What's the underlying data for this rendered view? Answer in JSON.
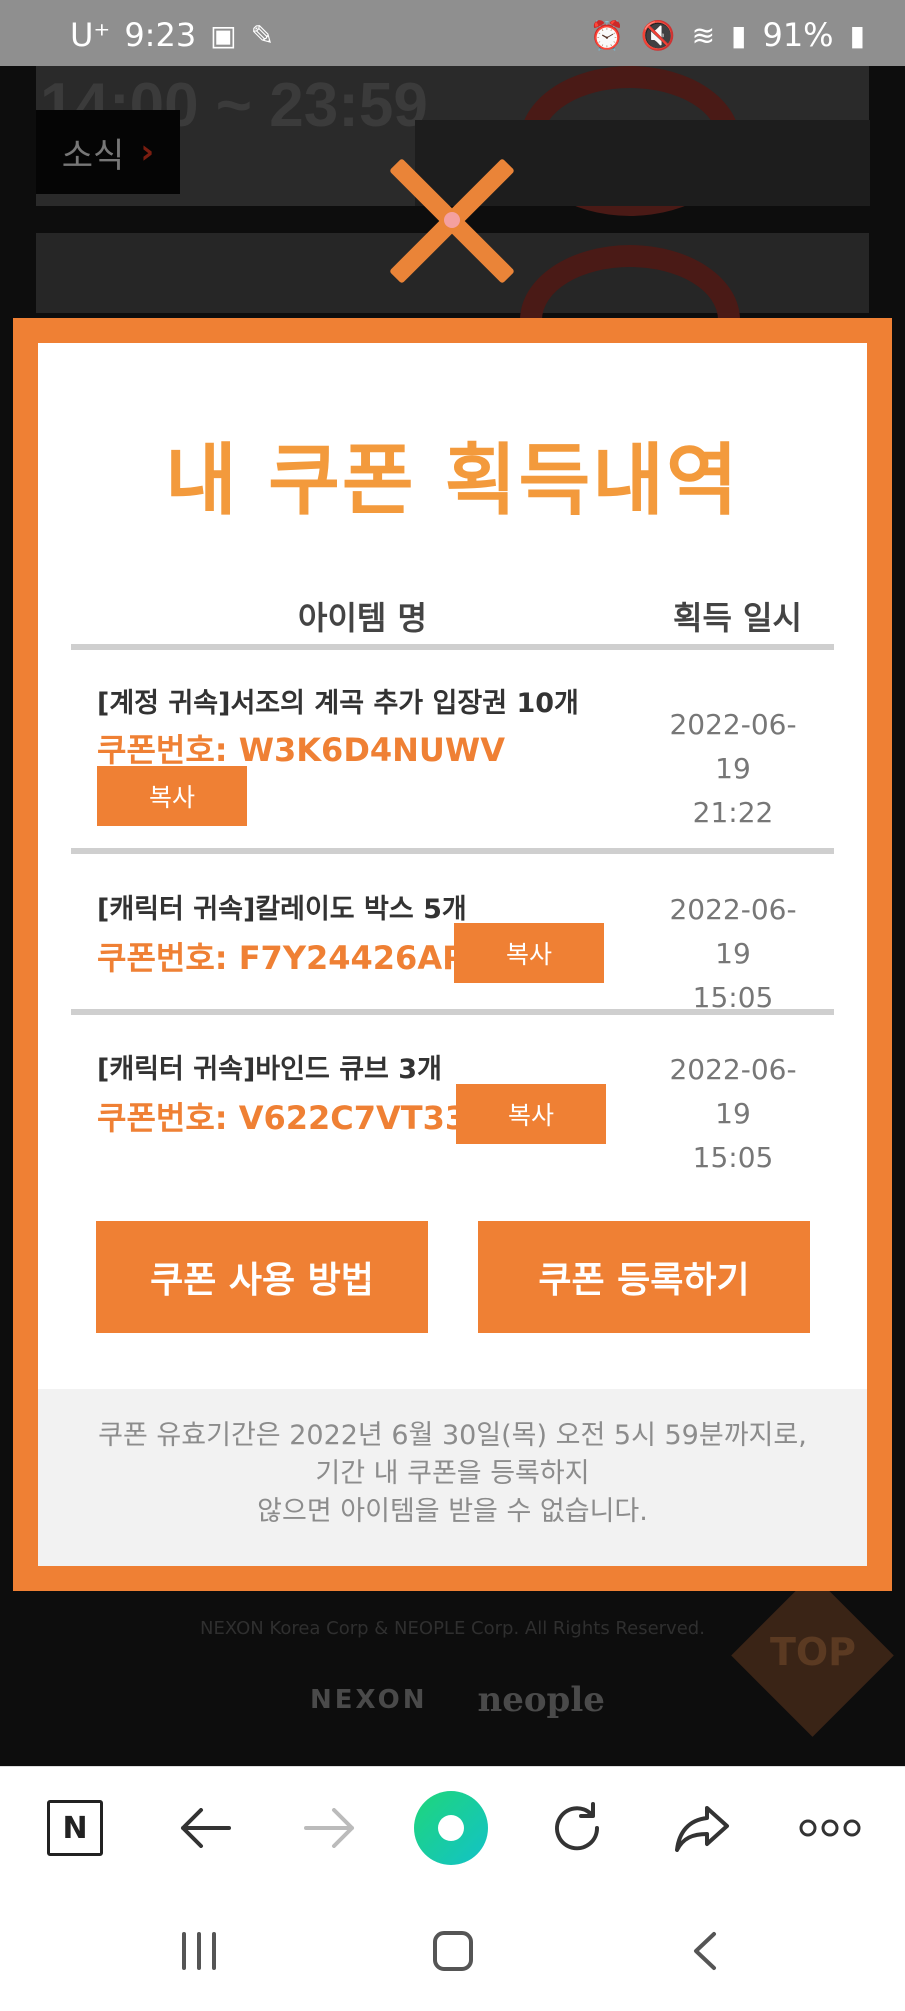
{
  "status_bar": {
    "carrier": "U⁺",
    "time": "9:23",
    "battery": "91%"
  },
  "background": {
    "event_time": "14:00 ~ 23:59",
    "news_label": "소식",
    "news_arrow": "›"
  },
  "modal": {
    "title": "내 쿠폰 획득내역",
    "col_item": "아이템 명",
    "col_date": "획득 일시",
    "coupons": [
      {
        "name": "[계정 귀속]서조의 계곡 추가 입장권 10개",
        "code": "쿠폰번호: W3K6D4NUWV",
        "copy": "복사",
        "date": "2022-06-19",
        "time": "21:22"
      },
      {
        "name": "[캐릭터 귀속]칼레이도 박스 5개",
        "code": "쿠폰번호: F7Y24426AP",
        "copy": "복사",
        "date": "2022-06-19",
        "time": "15:05"
      },
      {
        "name": "[캐릭터 귀속]바인드 큐브 3개",
        "code": "쿠폰번호: V622C7VT33",
        "copy": "복사",
        "date": "2022-06-19",
        "time": "15:05"
      }
    ],
    "how_to_button": "쿠폰 사용 방법",
    "register_button": "쿠폰 등록하기",
    "notice_lines": [
      "쿠폰 유효기간은 2022년 6월 30일(목) 오전 5시 59분까지로,",
      "기간 내 쿠폰을 등록하지",
      "않으면 아이템을 받을 수 없습니다."
    ]
  },
  "footer": {
    "copyright": "NEXON Korea Corp & NEOPLE Corp. All Rights Reserved.",
    "logo_nexon": "NEXON",
    "logo_neople": "neople",
    "top_button": "TOP"
  },
  "browser": {
    "naver_label": "N"
  }
}
